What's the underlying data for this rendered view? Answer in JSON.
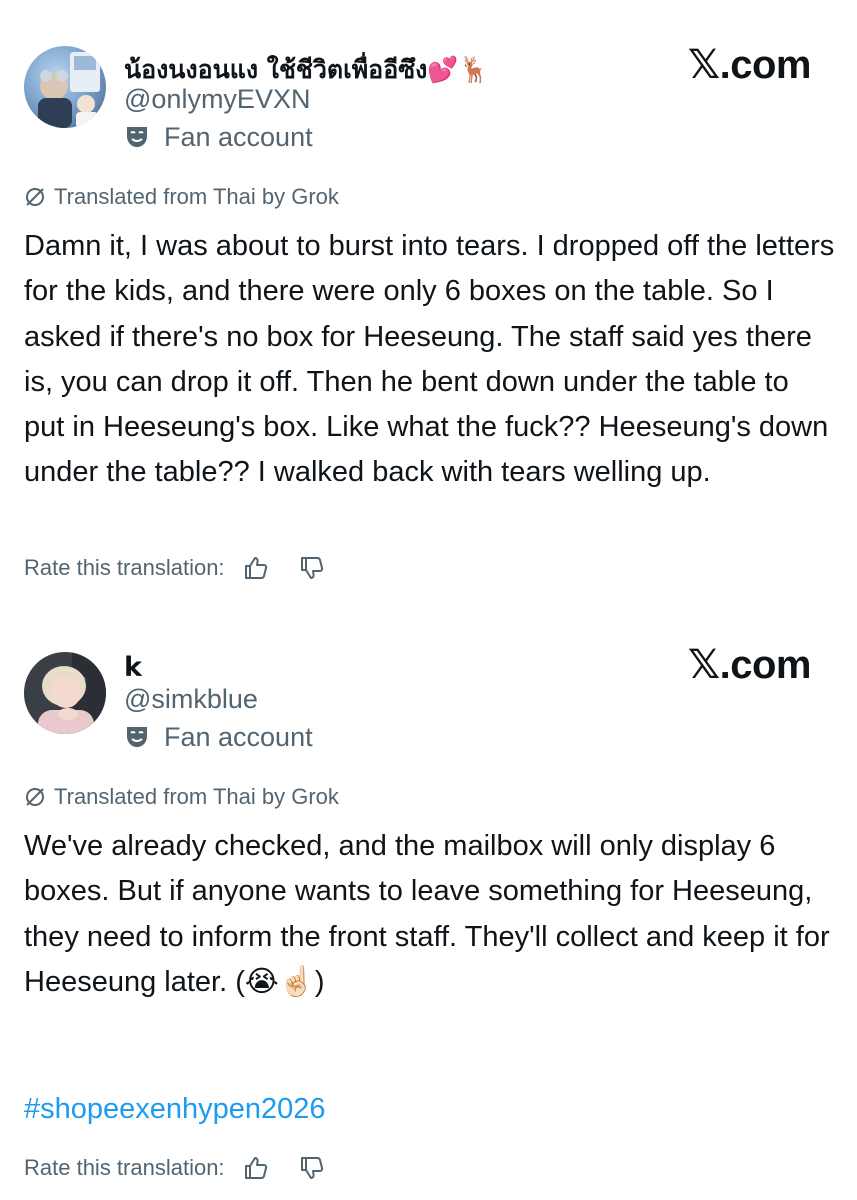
{
  "posts": [
    {
      "display_name": "น้องนงอนแง ใช้ชีวิตเพื่ออีซึง💕🦌",
      "handle": "@onlymyEVXN",
      "badge_label": "Fan account",
      "brand": "𝕏.com",
      "translated_label": "Translated from Thai by Grok",
      "body": "Damn it, I was about to burst into tears. I dropped off the letters for the kids, and there were only 6 boxes on the table. So I asked if there's no box for Heeseung. The staff said yes there is, you can drop it off. Then he bent down under the table to put in Heeseung's box. Like what the fuck?? Heeseung's down under the table?? I walked back with tears welling up.",
      "rate_label": "Rate this translation:",
      "icons": [
        "fan-account-mask-icon",
        "grok-translate-icon",
        "thumbs-up-icon",
        "thumbs-down-icon"
      ]
    },
    {
      "display_name": "k",
      "handle": "@simkblue",
      "badge_label": "Fan account",
      "brand": "𝕏.com",
      "translated_label": "Translated from Thai by Grok",
      "body": "We've already checked, and the mailbox will only display 6 boxes. But if anyone wants to leave something for Heeseung, they need to inform the front staff. They'll collect and keep it for Heeseung later. (😭☝🏻)",
      "hashtag": "#shopeexenhypen2026",
      "rate_label": "Rate this translation:",
      "icons": [
        "fan-account-mask-icon",
        "grok-translate-icon",
        "thumbs-up-icon",
        "thumbs-down-icon"
      ]
    }
  ],
  "colors": {
    "text_primary": "#0f1419",
    "text_secondary": "#536471",
    "link": "#1d9bf0",
    "background": "#ffffff"
  }
}
